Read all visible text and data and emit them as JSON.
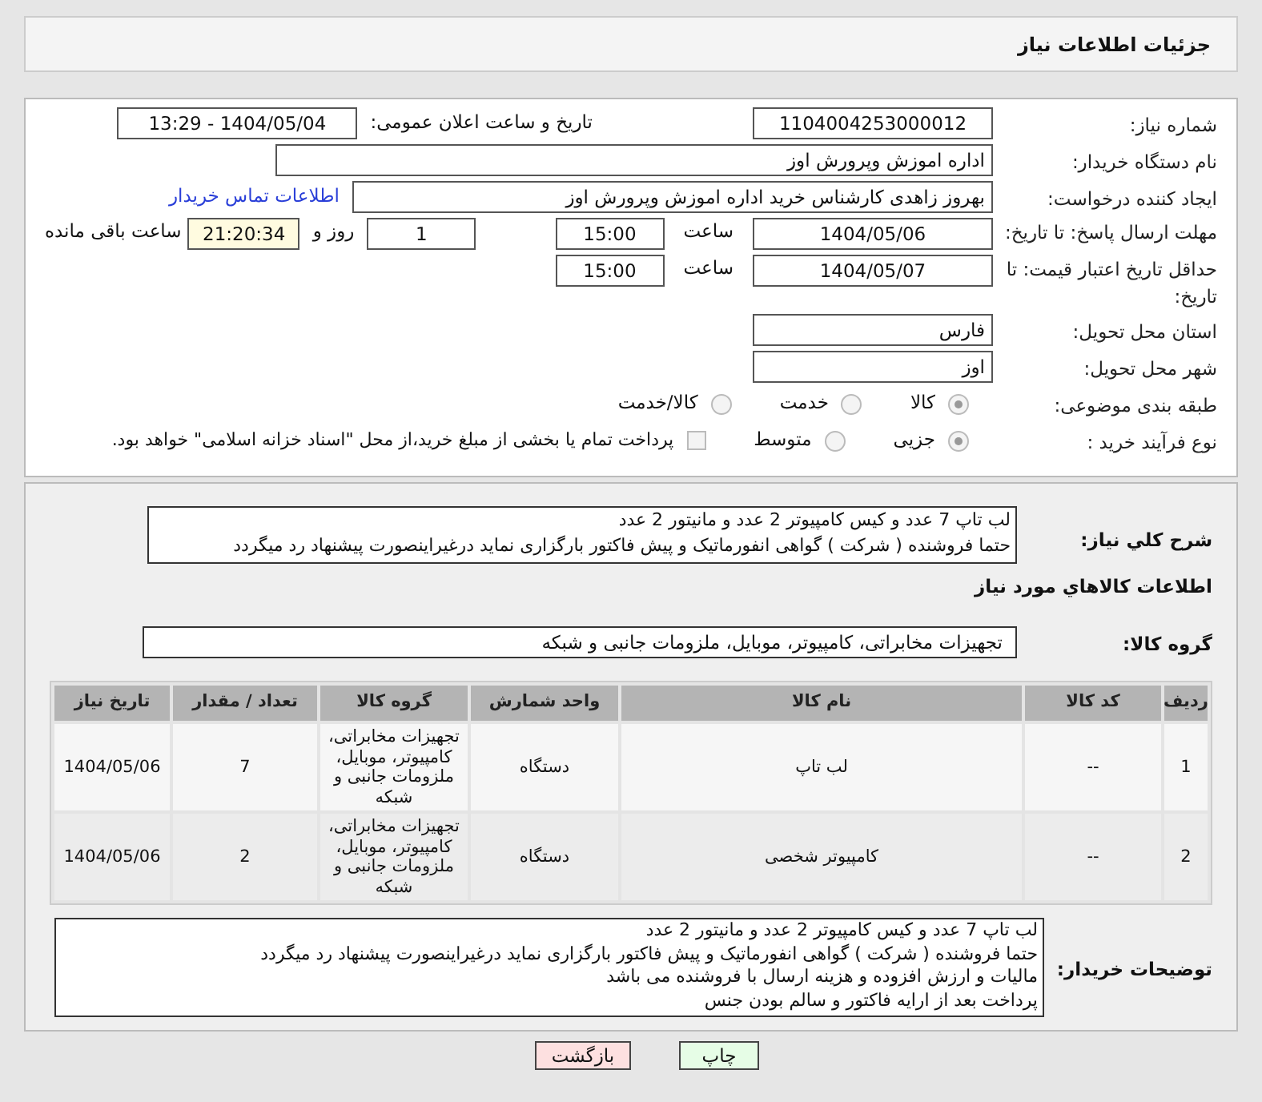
{
  "title": "جزئیات اطلاعات نیاز",
  "need_number": {
    "label": "شماره نیاز:",
    "value": "1104004253000012"
  },
  "announce": {
    "label": "تاریخ و ساعت اعلان عمومی:",
    "value": "1404/05/04 - 13:29"
  },
  "buyer_org": {
    "label": "نام دستگاه خریدار:",
    "value": "اداره اموزش وپرورش اوز"
  },
  "requester": {
    "label": "ایجاد کننده درخواست:",
    "value": "بهروز  زاهدی  کارشناس خرید اداره اموزش وپرورش اوز",
    "link": "اطلاعات تماس خریدار"
  },
  "deadline": {
    "label": "مهلت ارسال پاسخ: تا تاریخ:",
    "date": "1404/05/06",
    "time_label": "ساعت",
    "time": "15:00",
    "days": "1",
    "days_label": "روز و",
    "remaining": "21:20:34",
    "remaining_label": "ساعت باقی مانده"
  },
  "validity": {
    "label": "حداقل تاریخ اعتبار قیمت: تا تاریخ:",
    "date": "1404/05/07",
    "time_label": "ساعت",
    "time": "15:00"
  },
  "province": {
    "label": "استان محل تحویل:",
    "value": "فارس"
  },
  "city": {
    "label": "شهر محل تحویل:",
    "value": "اوز"
  },
  "category": {
    "label": "طبقه بندی موضوعی:",
    "options": [
      {
        "label": "کالا",
        "selected": true
      },
      {
        "label": "خدمت",
        "selected": false
      },
      {
        "label": "کالا/خدمت",
        "selected": false
      }
    ]
  },
  "process": {
    "label": "نوع فرآیند خرید :",
    "options": [
      {
        "label": "جزیی",
        "selected": true
      },
      {
        "label": "متوسط",
        "selected": false
      }
    ],
    "payment": {
      "checked": false,
      "text": "پرداخت تمام یا بخشی از مبلغ خرید،از محل \"اسناد خزانه اسلامی\" خواهد بود."
    }
  },
  "description": {
    "label": "شرح كلي نياز:",
    "lines": [
      "لب تاپ 7 عدد و کیس کامپیوتر 2 عدد و مانیتور 2 عدد",
      "حتما فروشنده ( شرکت ) گواهی انفورماتیک و پیش فاکتور بارگزاری نماید درغیراینصورت پیشنهاد رد میگردد"
    ]
  },
  "goods_title": "اطلاعات كالاهاي مورد نياز",
  "goods_group": {
    "label": "گروه کالا:",
    "value": "تجهیزات مخابراتی، کامپیوتر، موبایل، ملزومات جانبی و شبکه"
  },
  "table": {
    "columns": [
      "ردیف",
      "کد کالا",
      "نام کالا",
      "واحد شمارش",
      "گروه کالا",
      "تعداد / مقدار",
      "تاریخ نیاز"
    ],
    "rows": [
      [
        "1",
        "--",
        "لب تاپ",
        "دستگاه",
        "تجهیزات مخابراتی، کامپیوتر، موبایل، ملزومات جانبی و شبکه",
        "7",
        "1404/05/06"
      ],
      [
        "2",
        "--",
        "کامپیوتر شخصی",
        "دستگاه",
        "تجهیزات مخابراتی، کامپیوتر، موبایل، ملزومات جانبی و شبکه",
        "2",
        "1404/05/06"
      ]
    ]
  },
  "buyer_notes": {
    "label": "توضیحات خریدار:",
    "lines": [
      "لب تاپ 7 عدد و کیس کامپیوتر 2 عدد و مانیتور 2 عدد",
      "حتما فروشنده ( شرکت ) گواهی انفورماتیک و پیش فاکتور بارگزاری نماید درغیراینصورت پیشنهاد رد میگردد",
      "مالیات و ارزش افزوده و هزینه ارسال با فروشنده می باشد",
      "پرداخت بعد از ارایه فاکتور و سالم بودن جنس"
    ]
  },
  "buttons": [
    {
      "label": "چاپ",
      "kind": "print"
    },
    {
      "label": "بازگشت",
      "kind": "back"
    }
  ]
}
